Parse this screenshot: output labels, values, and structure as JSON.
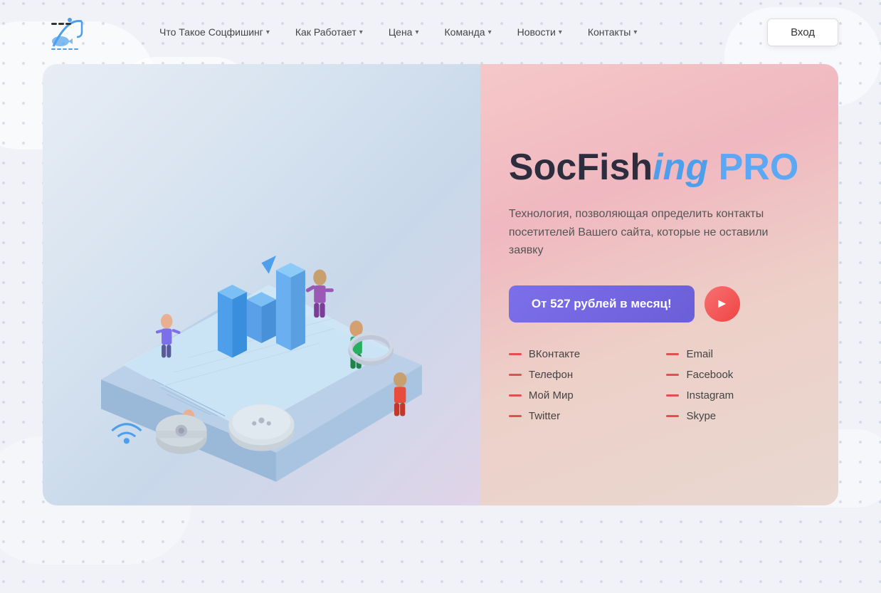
{
  "site": {
    "name": "SocFishing"
  },
  "header": {
    "login_label": "Вход",
    "nav": [
      {
        "id": "what",
        "label": "Что Такое Соцфишинг",
        "has_dropdown": true
      },
      {
        "id": "how",
        "label": "Как Работает",
        "has_dropdown": true
      },
      {
        "id": "price",
        "label": "Цена",
        "has_dropdown": true
      },
      {
        "id": "team",
        "label": "Команда",
        "has_dropdown": true
      },
      {
        "id": "news",
        "label": "Новости",
        "has_dropdown": true
      },
      {
        "id": "contacts",
        "label": "Контакты",
        "has_dropdown": true
      }
    ]
  },
  "hero": {
    "title_part1": "SocFish",
    "title_part2": "ing ",
    "title_pro": "PRO",
    "subtitle": "Технология, позволяющая определить контакты посетителей Вашего сайта, которые не оставили заявку",
    "cta_label_prefix": "От ",
    "cta_price": "527",
    "cta_label_suffix": " рублей в месяц!",
    "features": [
      {
        "col": 1,
        "label": "ВКонтакте"
      },
      {
        "col": 1,
        "label": "Телефон"
      },
      {
        "col": 1,
        "label": "Мой Мир"
      },
      {
        "col": 1,
        "label": "Twitter"
      },
      {
        "col": 2,
        "label": "Email"
      },
      {
        "col": 2,
        "label": "Facebook"
      },
      {
        "col": 2,
        "label": "Instagram"
      },
      {
        "col": 2,
        "label": "Skype"
      }
    ]
  },
  "colors": {
    "accent_blue": "#5ba8f5",
    "accent_purple": "#7c6fea",
    "accent_red": "#ef4444",
    "dash_red": "#e05050"
  }
}
